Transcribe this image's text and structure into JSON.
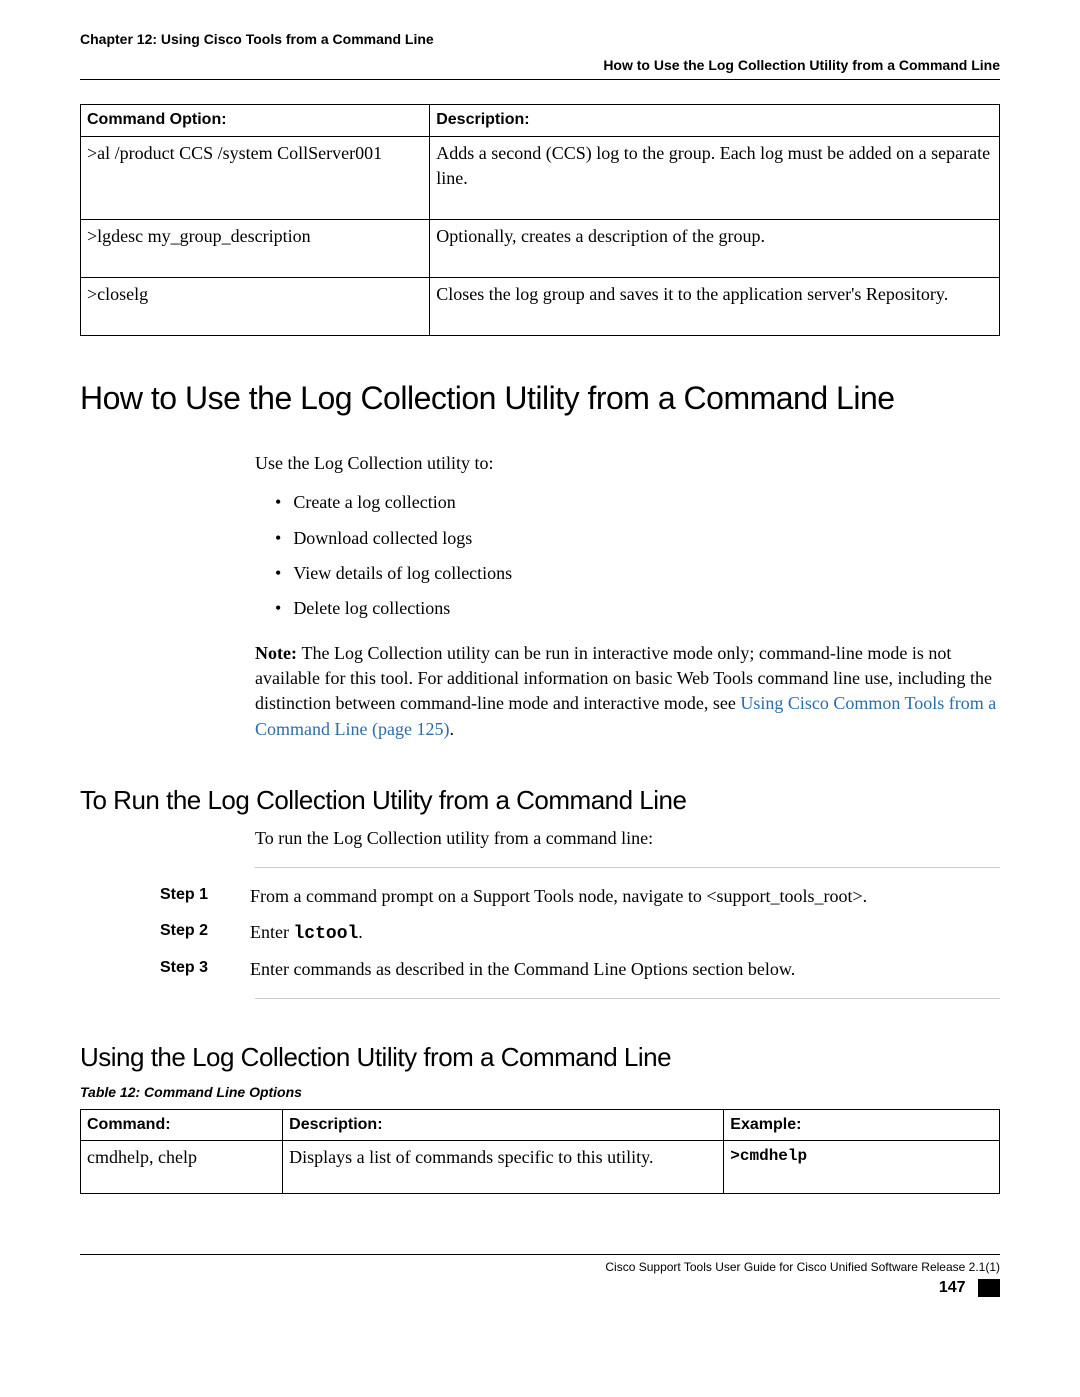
{
  "header": {
    "chapter": "Chapter 12: Using Cisco Tools from a Command Line",
    "section": "How to Use the Log Collection Utility from a Command Line"
  },
  "table1": {
    "headers": {
      "col1": "Command Option:",
      "col2": "Description:"
    },
    "rows": [
      {
        "cmd": ">al /product CCS /system CollServer001",
        "desc": "Adds a second (CCS) log to the group. Each log must be added on a separate line."
      },
      {
        "cmd": ">lgdesc my_group_description",
        "desc": "Optionally, creates a description of the group."
      },
      {
        "cmd": ">closelg",
        "desc": "Closes the log group and saves it to the application server's Repository."
      }
    ]
  },
  "h1": "How to Use the Log Collection Utility from a Command Line",
  "intro": "Use the Log Collection utility to:",
  "bullets": [
    "Create a log collection",
    "Download collected logs",
    "View details of log collections",
    "Delete log collections"
  ],
  "note": {
    "label": "Note: ",
    "text_pre": "The Log Collection utility can be run in interactive mode only; command-line mode is not available for this tool. For additional information on basic Web Tools command line use, including the distinction between command-line mode and interactive mode, see ",
    "link": "Using Cisco Common Tools from a Command Line (page 125)",
    "text_post": "."
  },
  "h2a": "To Run the Log Collection Utility from a Command Line",
  "run_intro": "To run the Log Collection utility from a command line:",
  "steps": [
    {
      "label": "Step 1",
      "text": "From a command prompt on a Support Tools node, navigate to <support_tools_root>."
    },
    {
      "label": "Step 2",
      "text_pre": "Enter ",
      "code": "lctool",
      "text_post": "."
    },
    {
      "label": "Step 3",
      "text": "Enter commands as described in the Command Line Options section below."
    }
  ],
  "h2b": "Using the Log Collection Utility from a Command Line",
  "table2": {
    "caption": "Table 12: Command Line Options",
    "headers": {
      "col1": "Command:",
      "col2": "Description:",
      "col3": "Example:"
    },
    "rows": [
      {
        "cmd": "cmdhelp, chelp",
        "desc": "Displays a list of commands specific to this utility.",
        "ex": ">cmdhelp"
      }
    ]
  },
  "footer": {
    "doc": "Cisco Support Tools User Guide for Cisco Unified Software Release 2.1(1)",
    "page": "147"
  }
}
